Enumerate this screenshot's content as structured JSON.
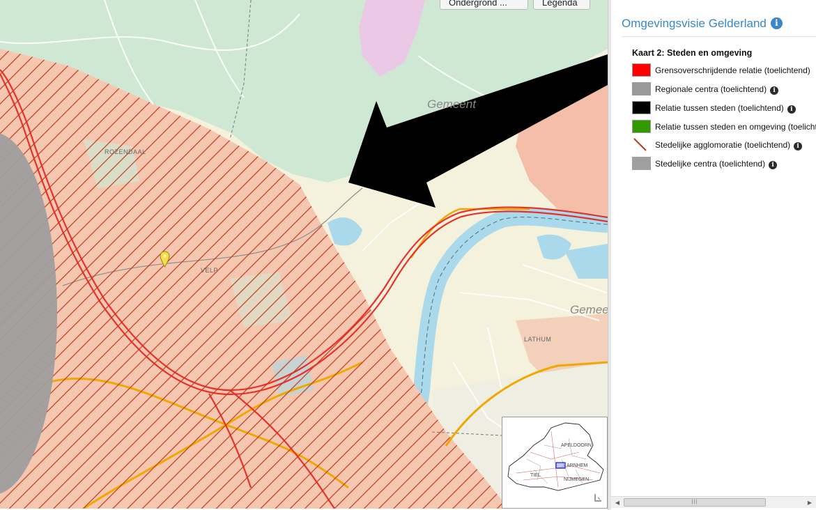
{
  "map": {
    "buttons": {
      "underground": "Ondergrond ...",
      "legend": "Legenda"
    },
    "labels": {
      "rozendaal": "ROZENDAAL",
      "velp": "VELP",
      "lathum": "LATHUM",
      "gemeente_top": "Gemeent",
      "gemeente_right": "Gemeen"
    },
    "overview": {
      "labels": {
        "apeldoorn": "APELDOORN",
        "arnhem": "ARNHEM",
        "nijmegen": "NIJMEGEN",
        "tiel": "TIEL"
      }
    },
    "colors": {
      "hatch": "#c0391b",
      "hatch_bg": "#f6c7b0",
      "forest": "#cfe8d3",
      "water": "#a9d9ea",
      "built": "#f3b59f",
      "regional_center": "#9e9e9e"
    },
    "marker_icon": "map-pin-icon"
  },
  "panel": {
    "title": "Omgevingsvisie Gelderland",
    "title_icon": "info-icon",
    "legend_heading": "Kaart 2: Steden en omgeving",
    "legend_items": [
      {
        "label": "Grensoverschrijdende relatie (toelichtend)",
        "color": "#ff0000",
        "pattern": "solid"
      },
      {
        "label": "Regionale centra (toelichtend)",
        "color": "#999999",
        "pattern": "solid"
      },
      {
        "label": "Relatie tussen steden (toelichtend)",
        "color": "#000000",
        "pattern": "solid"
      },
      {
        "label": "Relatie tussen steden en omgeving (toelichtend)",
        "color": "#339900",
        "pattern": "solid"
      },
      {
        "label": "Stedelijke agglomoratie (toelichtend)",
        "color": "#c0391b",
        "pattern": "hatch"
      },
      {
        "label": "Stedelijke centra (toelichtend)",
        "color": "#a0a0a0",
        "pattern": "solid"
      }
    ]
  }
}
